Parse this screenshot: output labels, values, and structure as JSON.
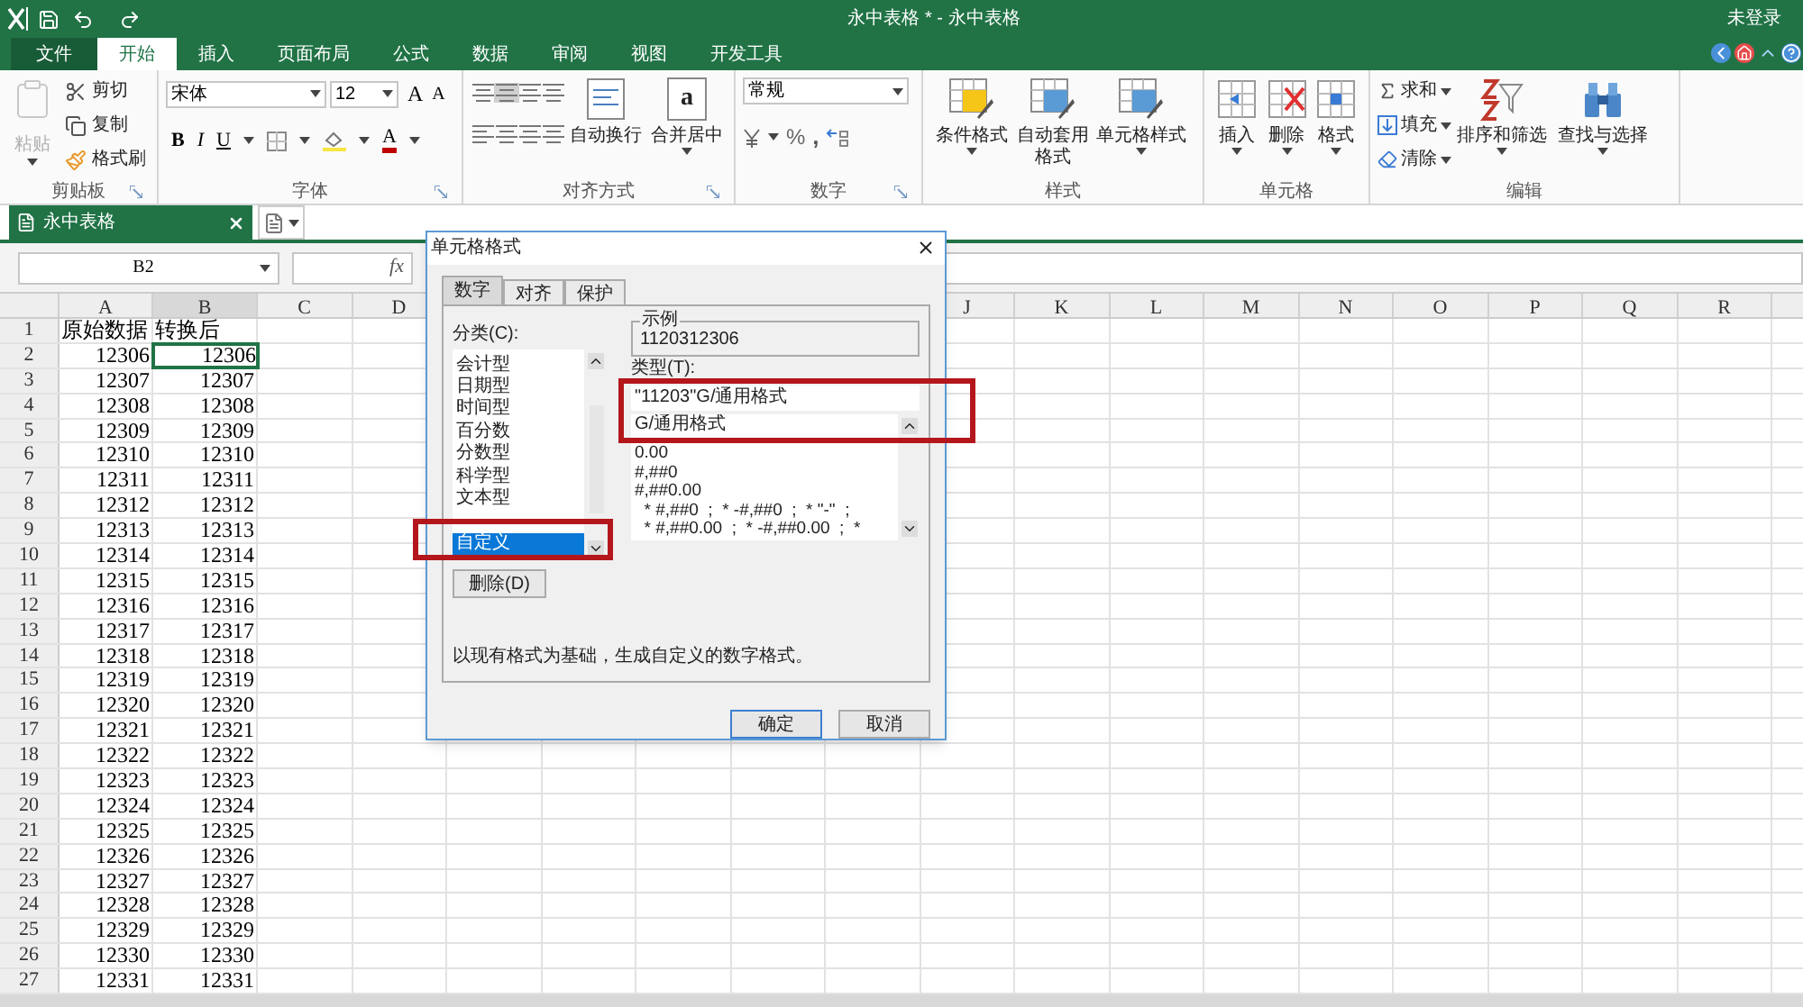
{
  "title_bar": {
    "title": "永中表格 * - 永中表格",
    "account": "未登录"
  },
  "ribbon_tabs": [
    {
      "label": "文件",
      "kind": "file",
      "selected": false
    },
    {
      "label": "开始",
      "kind": "tab",
      "selected": true
    },
    {
      "label": "插入",
      "kind": "tab",
      "selected": false
    },
    {
      "label": "页面布局",
      "kind": "tab",
      "selected": false
    },
    {
      "label": "公式",
      "kind": "tab",
      "selected": false
    },
    {
      "label": "数据",
      "kind": "tab",
      "selected": false
    },
    {
      "label": "审阅",
      "kind": "tab",
      "selected": false
    },
    {
      "label": "视图",
      "kind": "tab",
      "selected": false
    },
    {
      "label": "开发工具",
      "kind": "tab",
      "selected": false
    }
  ],
  "ribbon": {
    "clipboard": {
      "label": "剪贴板",
      "paste": {
        "label": "粘贴",
        "disabled": true
      },
      "actions": [
        "剪切",
        "复制",
        "格式刷"
      ]
    },
    "font": {
      "label": "字体",
      "font_name": "宋体",
      "font_size": "12",
      "grow": "A",
      "shrink": "A",
      "styles": [
        "B",
        "I",
        "U"
      ],
      "color_letter": "A"
    },
    "alignment": {
      "label": "对齐方式",
      "wrap": "自动换行",
      "merge": "合并居中",
      "merge_letter": "a"
    },
    "number": {
      "label": "数字",
      "format": "常规",
      "percent": "%",
      "comma": ","
    },
    "styles": {
      "label": "样式",
      "buttons": [
        "条件格式",
        "自动套用格式",
        "单元格样式"
      ]
    },
    "cells": {
      "label": "单元格",
      "buttons": [
        "插入",
        "删除",
        "格式"
      ]
    },
    "editing": {
      "label": "编辑",
      "small": [
        "求和",
        "填充",
        "清除"
      ],
      "large": [
        "排序和筛选",
        "查找与选择"
      ]
    }
  },
  "doc_tabs": [
    {
      "label": "永中表格",
      "selected": true
    }
  ],
  "name_box": "B2",
  "fx": "fx",
  "columns_left": [
    "A",
    "B",
    "C",
    "D"
  ],
  "columns_right": [
    "J",
    "K",
    "L",
    "M",
    "N",
    "O",
    "P",
    "Q",
    "R"
  ],
  "rows": [
    {
      "n": "1",
      "a": "原始数据",
      "b": "转换后",
      "b_selected": false
    },
    {
      "n": "2",
      "a": "12306",
      "b": "12306",
      "b_selected": true
    },
    {
      "n": "3",
      "a": "12307",
      "b": "12307",
      "b_selected": false
    },
    {
      "n": "4",
      "a": "12308",
      "b": "12308",
      "b_selected": false
    },
    {
      "n": "5",
      "a": "12309",
      "b": "12309",
      "b_selected": false
    },
    {
      "n": "6",
      "a": "12310",
      "b": "12310",
      "b_selected": false
    },
    {
      "n": "7",
      "a": "12311",
      "b": "12311",
      "b_selected": false
    },
    {
      "n": "8",
      "a": "12312",
      "b": "12312",
      "b_selected": false
    },
    {
      "n": "9",
      "a": "12313",
      "b": "12313",
      "b_selected": false
    },
    {
      "n": "10",
      "a": "12314",
      "b": "12314",
      "b_selected": false
    },
    {
      "n": "11",
      "a": "12315",
      "b": "12315",
      "b_selected": false
    },
    {
      "n": "12",
      "a": "12316",
      "b": "12316",
      "b_selected": false
    },
    {
      "n": "13",
      "a": "12317",
      "b": "12317",
      "b_selected": false
    },
    {
      "n": "14",
      "a": "12318",
      "b": "12318",
      "b_selected": false
    },
    {
      "n": "15",
      "a": "12319",
      "b": "12319",
      "b_selected": false
    },
    {
      "n": "16",
      "a": "12320",
      "b": "12320",
      "b_selected": false
    },
    {
      "n": "17",
      "a": "12321",
      "b": "12321",
      "b_selected": false
    },
    {
      "n": "18",
      "a": "12322",
      "b": "12322",
      "b_selected": false
    },
    {
      "n": "19",
      "a": "12323",
      "b": "12323",
      "b_selected": false
    },
    {
      "n": "20",
      "a": "12324",
      "b": "12324",
      "b_selected": false
    },
    {
      "n": "21",
      "a": "12325",
      "b": "12325",
      "b_selected": false
    },
    {
      "n": "22",
      "a": "12326",
      "b": "12326",
      "b_selected": false
    },
    {
      "n": "23",
      "a": "12327",
      "b": "12327",
      "b_selected": false
    },
    {
      "n": "24",
      "a": "12328",
      "b": "12328",
      "b_selected": false
    },
    {
      "n": "25",
      "a": "12329",
      "b": "12329",
      "b_selected": false
    },
    {
      "n": "26",
      "a": "12330",
      "b": "12330",
      "b_selected": false
    },
    {
      "n": "27",
      "a": "12331",
      "b": "12331",
      "b_selected": false
    }
  ],
  "dialog": {
    "title": "单元格格式",
    "tabs": [
      {
        "label": "数字",
        "selected": true
      },
      {
        "label": "对齐",
        "selected": false
      },
      {
        "label": "保护",
        "selected": false
      }
    ],
    "category_label": "分类(C):",
    "categories": [
      {
        "label": "会计型",
        "selected": false,
        "highlighted": false
      },
      {
        "label": "日期型",
        "selected": false,
        "highlighted": false
      },
      {
        "label": "时间型",
        "selected": false,
        "highlighted": false
      },
      {
        "label": "百分数",
        "selected": false,
        "highlighted": false
      },
      {
        "label": "分数型",
        "selected": false,
        "highlighted": false
      },
      {
        "label": "科学型",
        "selected": false,
        "highlighted": false
      },
      {
        "label": "文本型",
        "selected": false,
        "highlighted": false
      },
      {
        "label": "自定义",
        "selected": true,
        "highlighted": true
      }
    ],
    "delete_button": "删除(D)",
    "sample_label": "示例",
    "sample": "1120312306",
    "type_label": "类型(T):",
    "type_value": "\"11203\"G/通用格式",
    "type_highlighted": true,
    "types": [
      "G/通用格式",
      "0.00",
      "#,##0",
      "#,##0.00",
      "  * #,##0  ;  * -#,##0  ;  * \"-\"  ;",
      "  * #,##0.00  ;  * -#,##0.00  ;  *"
    ],
    "description": "以现有格式为基础，生成自定义的数字格式。",
    "ok": "确定",
    "cancel": "取消"
  }
}
